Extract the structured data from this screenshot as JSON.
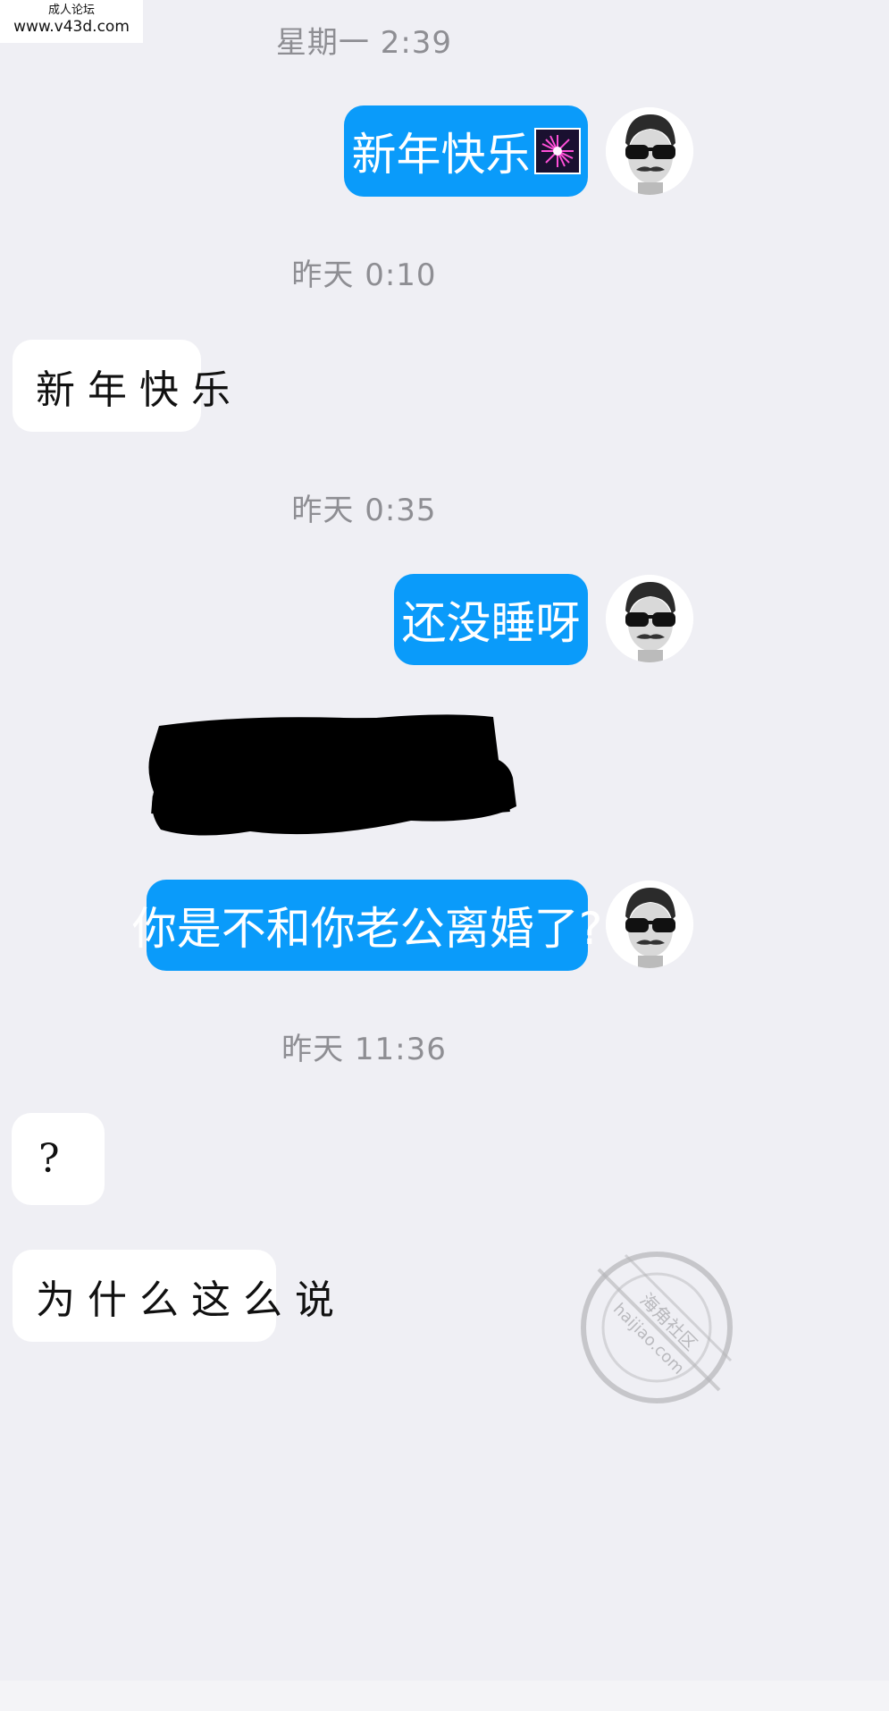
{
  "watermark": {
    "line1": "成人论坛",
    "line2": "www.v43d.com"
  },
  "conversation": [
    {
      "kind": "timestamp",
      "text": "星期一 2:39"
    },
    {
      "kind": "outgoing",
      "text": "新年快乐",
      "emoji": "🎆"
    },
    {
      "kind": "timestamp",
      "text": "昨天 0:10"
    },
    {
      "kind": "incoming",
      "text": "新年快乐"
    },
    {
      "kind": "timestamp",
      "text": "昨天 0:35"
    },
    {
      "kind": "outgoing",
      "text": "还没睡呀"
    },
    {
      "kind": "redacted"
    },
    {
      "kind": "outgoing",
      "text": "你是不和你老公离婚了?"
    },
    {
      "kind": "timestamp",
      "text": "昨天 11:36"
    },
    {
      "kind": "incoming",
      "text": "?"
    },
    {
      "kind": "incoming",
      "text": "为什么这么说"
    }
  ],
  "corner_watermark": {
    "text_cn": "海角社区",
    "text_en": "haijiao.com"
  },
  "colors": {
    "background": "#efeff4",
    "outgoing_bubble": "#0a9bfa",
    "incoming_bubble": "#ffffff",
    "timestamp_text": "#8e8e93"
  }
}
